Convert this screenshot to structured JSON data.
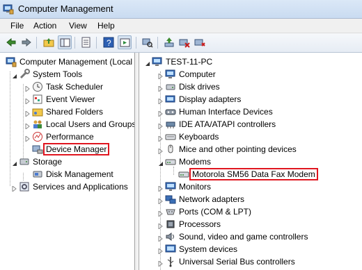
{
  "window": {
    "title": "Computer Management"
  },
  "menu": [
    "File",
    "Action",
    "View",
    "Help"
  ],
  "toolbar": {
    "icons": [
      "back-arrow-icon",
      "forward-arrow-icon",
      "up-folder-icon",
      "show-hide-tree-icon",
      "properties-icon",
      "help-icon",
      "action-pane-icon",
      "scan-hardware-icon",
      "update-driver-icon",
      "disable-device-icon",
      "uninstall-device-icon"
    ]
  },
  "left_tree": [
    {
      "label": "Computer Management (Local",
      "level": 0,
      "expander": "",
      "icon": "computer-management-icon"
    },
    {
      "label": "System Tools",
      "level": 1,
      "expander": "open",
      "icon": "system-tools-icon"
    },
    {
      "label": "Task Scheduler",
      "level": 2,
      "expander": "closed",
      "icon": "clock-icon"
    },
    {
      "label": "Event Viewer",
      "level": 2,
      "expander": "closed",
      "icon": "event-viewer-icon"
    },
    {
      "label": "Shared Folders",
      "level": 2,
      "expander": "closed",
      "icon": "shared-folder-icon"
    },
    {
      "label": "Local Users and Groups",
      "level": 2,
      "expander": "closed",
      "icon": "users-icon"
    },
    {
      "label": "Performance",
      "level": 2,
      "expander": "closed",
      "icon": "performance-icon"
    },
    {
      "label": "Device Manager",
      "level": 2,
      "expander": "",
      "icon": "device-manager-icon",
      "highlighted": true
    },
    {
      "label": "Storage",
      "level": 1,
      "expander": "open",
      "icon": "storage-icon"
    },
    {
      "label": "Disk Management",
      "level": 2,
      "expander": "",
      "icon": "disk-management-icon"
    },
    {
      "label": "Services and Applications",
      "level": 1,
      "expander": "closed",
      "icon": "services-icon"
    }
  ],
  "right_tree": [
    {
      "label": "TEST-11-PC",
      "level": 0,
      "expander": "open",
      "icon": "computer-icon"
    },
    {
      "label": "Computer",
      "level": 1,
      "expander": "closed",
      "icon": "computer-icon"
    },
    {
      "label": "Disk drives",
      "level": 1,
      "expander": "closed",
      "icon": "disk-drive-icon"
    },
    {
      "label": "Display adapters",
      "level": 1,
      "expander": "closed",
      "icon": "display-adapter-icon"
    },
    {
      "label": "Human Interface Devices",
      "level": 1,
      "expander": "closed",
      "icon": "hid-icon"
    },
    {
      "label": "IDE ATA/ATAPI controllers",
      "level": 1,
      "expander": "closed",
      "icon": "ide-icon"
    },
    {
      "label": "Keyboards",
      "level": 1,
      "expander": "closed",
      "icon": "keyboard-icon"
    },
    {
      "label": "Mice and other pointing devices",
      "level": 1,
      "expander": "closed",
      "icon": "mouse-icon"
    },
    {
      "label": "Modems",
      "level": 1,
      "expander": "open",
      "icon": "modem-icon"
    },
    {
      "label": "Motorola SM56 Data Fax Modem",
      "level": 2,
      "expander": "",
      "icon": "modem-icon",
      "highlighted": true
    },
    {
      "label": "Monitors",
      "level": 1,
      "expander": "closed",
      "icon": "monitor-icon"
    },
    {
      "label": "Network adapters",
      "level": 1,
      "expander": "closed",
      "icon": "network-adapter-icon"
    },
    {
      "label": "Ports (COM & LPT)",
      "level": 1,
      "expander": "closed",
      "icon": "port-icon"
    },
    {
      "label": "Processors",
      "level": 1,
      "expander": "closed",
      "icon": "processor-icon"
    },
    {
      "label": "Sound, video and game controllers",
      "level": 1,
      "expander": "closed",
      "icon": "sound-icon"
    },
    {
      "label": "System devices",
      "level": 1,
      "expander": "closed",
      "icon": "system-device-icon"
    },
    {
      "label": "Universal Serial Bus controllers",
      "level": 1,
      "expander": "closed",
      "icon": "usb-icon"
    }
  ],
  "colors": {
    "highlight_border": "#e0151f",
    "toolbar_bg": "#e6ecf4"
  }
}
